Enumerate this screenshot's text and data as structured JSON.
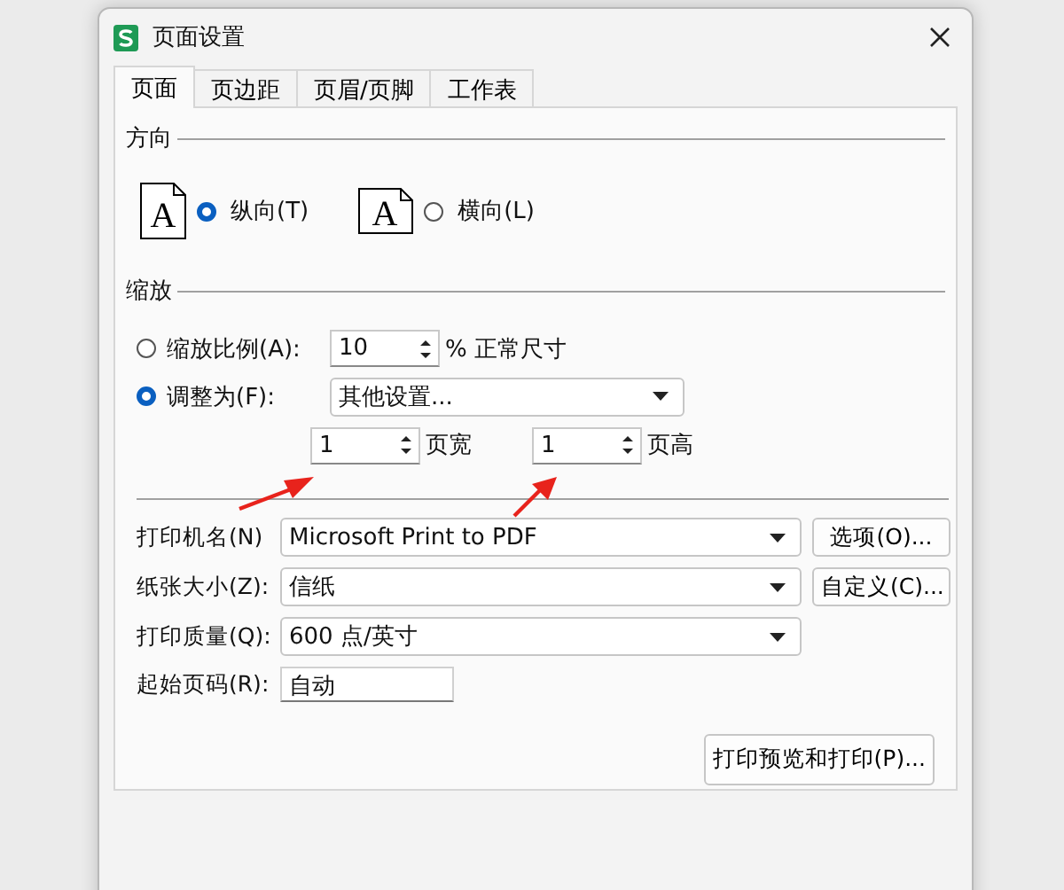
{
  "window": {
    "title": "页面设置"
  },
  "tabs": [
    {
      "label": "页面",
      "selected": true
    },
    {
      "label": "页边距",
      "selected": false
    },
    {
      "label": "页眉/页脚",
      "selected": false
    },
    {
      "label": "工作表",
      "selected": false
    }
  ],
  "orientation": {
    "title": "方向",
    "options": [
      {
        "label": "纵向(T)",
        "kind": "portrait",
        "icon_letter": "A",
        "selected": true
      },
      {
        "label": "横向(L)",
        "kind": "landscape",
        "icon_letter": "A",
        "selected": false
      }
    ]
  },
  "scaling": {
    "title": "缩放",
    "options": [
      {
        "label": "缩放比例(A):",
        "selected": false,
        "value": "10",
        "suffix": "% 正常尺寸"
      },
      {
        "label": "调整为(F):",
        "selected": true,
        "value": "其他设置..."
      }
    ],
    "fit": [
      {
        "value": "1",
        "unit": "页宽"
      },
      {
        "value": "1",
        "unit": "页高"
      }
    ]
  },
  "printer_fields": [
    {
      "label": "打印机名(N)",
      "kind": "dropdown",
      "value": "Microsoft Print to PDF",
      "button": "选项(O)..."
    },
    {
      "label": "纸张大小(Z):",
      "kind": "dropdown",
      "value": "信纸",
      "button": "自定义(C)..."
    },
    {
      "label": "打印质量(Q):",
      "kind": "dropdown",
      "value": "600 点/英寸"
    },
    {
      "label": "起始页码(R):",
      "kind": "text",
      "value": "自动"
    }
  ],
  "preview_button": "打印预览和打印(P)..."
}
